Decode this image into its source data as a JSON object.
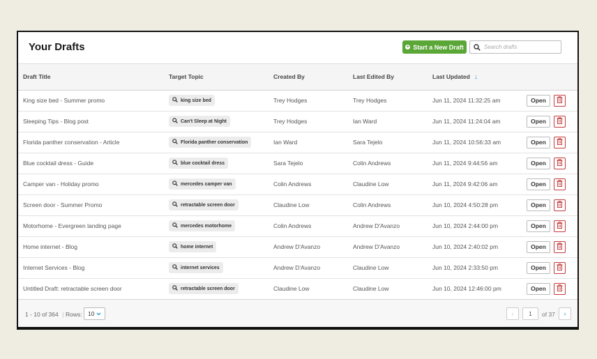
{
  "header": {
    "title": "Your Drafts",
    "new_draft_label": "Start a New Draft",
    "search_placeholder": "Search drafts"
  },
  "columns": {
    "title": "Draft Title",
    "topic": "Target Topic",
    "created_by": "Created By",
    "last_edited_by": "Last Edited By",
    "last_updated": "Last Updated"
  },
  "sort": {
    "column": "Last Updated",
    "direction": "descending"
  },
  "rows": [
    {
      "title": "King size bed - Summer promo",
      "topic": "king size bed",
      "created_by": "Trey Hodges",
      "edited_by": "Trey Hodges",
      "updated": "Jun 11, 2024 11:32:25 am",
      "open_label": "Open"
    },
    {
      "title": "Sleeping Tips - Blog post",
      "topic": "Can't Sleep at Night",
      "created_by": "Trey Hodges",
      "edited_by": "Ian Ward",
      "updated": "Jun 11, 2024 11:24:04 am",
      "open_label": "Open"
    },
    {
      "title": "Florida panther conservation - Article",
      "topic": "Florida panther conservation",
      "created_by": "Ian Ward",
      "edited_by": "Sara Tejelo",
      "updated": "Jun 11, 2024 10:56:33 am",
      "open_label": "Open"
    },
    {
      "title": "Blue cocktail dress - Guide",
      "topic": "blue cocktail dress",
      "created_by": "Sara Tejelo",
      "edited_by": "Colin Andrews",
      "updated": "Jun 11, 2024 9:44:56 am",
      "open_label": "Open"
    },
    {
      "title": "Camper van - Holiday promo",
      "topic": "mercedes camper van",
      "created_by": "Colin Andrews",
      "edited_by": "Claudine Low",
      "updated": "Jun 11, 2024 9:42:06 am",
      "open_label": "Open"
    },
    {
      "title": "Screen door - Summer Promo",
      "topic": "retractable screen door",
      "created_by": "Claudine Low",
      "edited_by": "Colin Andrews",
      "updated": "Jun 10, 2024 4:50:28 pm",
      "open_label": "Open"
    },
    {
      "title": "Motorhome - Evergreen landing page",
      "topic": "mercedes motorhome",
      "created_by": "Colin Andrews",
      "edited_by": "Andrew D'Avanzo",
      "updated": "Jun 10, 2024 2:44:00 pm",
      "open_label": "Open"
    },
    {
      "title": "Home internet - Blog",
      "topic": "home internet",
      "created_by": "Andrew D'Avanzo",
      "edited_by": "Andrew D'Avanzo",
      "updated": "Jun 10, 2024 2:40:02 pm",
      "open_label": "Open"
    },
    {
      "title": "Internet Services - Blog",
      "topic": "internet services",
      "created_by": "Andrew D'Avanzo",
      "edited_by": "Claudine Low",
      "updated": "Jun 10, 2024 2:33:50 pm",
      "open_label": "Open"
    },
    {
      "title": "Untitled Draft: retractable screen door",
      "topic": "retractable screen door",
      "created_by": "Claudine Low",
      "edited_by": "Claudine Low",
      "updated": "Jun 10, 2024 12:46:00 pm",
      "open_label": "Open"
    }
  ],
  "footer": {
    "range": "1 - 10 of 364",
    "separator": "|",
    "rows_label": "Rows:",
    "rows_value": "10",
    "page_value": "1",
    "page_of": "of 37"
  },
  "colors": {
    "accent_green": "#5aa637",
    "sort_blue": "#2a9ad6",
    "delete_red": "#c63a3a",
    "background": "#efede2"
  }
}
